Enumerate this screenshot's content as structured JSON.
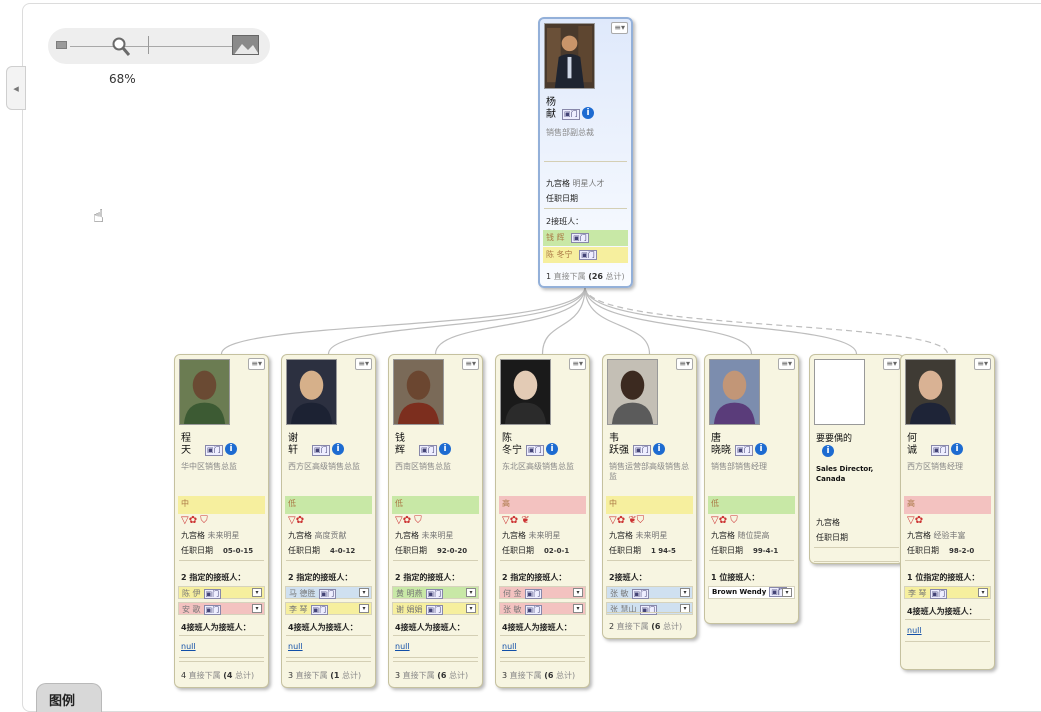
{
  "zoom": {
    "percent_label": "68%",
    "level": 0.35
  },
  "legend": {
    "label": "图例"
  },
  "labels": {
    "menu": "≡▾",
    "info": "i",
    "chat": "▣门",
    "loc_label": "九宫格",
    "date_label": "任职日期",
    "succ_designated": "2 指定的接班人：",
    "succ_two": "2接班人：",
    "succ_one": "1 位接班人：",
    "succ_one_designated": "1 位指定的接班人：",
    "succ_as": "4接班人为接班人：",
    "null_link": "null",
    "direct_reports": "直接下属",
    "total": "总计"
  },
  "root": {
    "name": "杨\n献",
    "title": "销售部副总裁",
    "loc_value": "明星人才",
    "succ_label": "2接班人：",
    "successors": [
      {
        "name": "钱 辉",
        "color": "g"
      },
      {
        "name": "陈 冬宁",
        "color": "y"
      }
    ],
    "footer_count": "1",
    "footer_total": "(26"
  },
  "cards": [
    {
      "name": "程\n天",
      "title": "华中区销售总监",
      "band": "中",
      "band_color": "y",
      "flags": "▽✿  ⛉",
      "loc_value": "未来明星",
      "date_value": "05-0-15",
      "succ_label": "2 指定的接班人：",
      "successors": [
        {
          "name": "陈 伊",
          "color": "y"
        },
        {
          "name": "安 歌",
          "color": "r"
        }
      ],
      "as_label": "4接班人为接班人：",
      "null": "null",
      "footer_count": "4",
      "footer_total": "(4"
    },
    {
      "name": "谢\n轩",
      "title": "西方区高级销售总监",
      "band": "低",
      "band_color": "g",
      "flags": "▽✿",
      "loc_value": "高度贡献",
      "date_value": "4-0-12",
      "succ_label": "2 指定的接班人：",
      "successors": [
        {
          "name": "马 德胜",
          "color": "b"
        },
        {
          "name": "李 琴",
          "color": "y"
        }
      ],
      "as_label": "4接班人为接班人：",
      "null": "null",
      "footer_count": "3",
      "footer_total": "(1"
    },
    {
      "name": "钱\n辉",
      "title": "西南区销售总监",
      "band": "低",
      "band_color": "g",
      "flags": "▽✿  ⛉",
      "loc_value": "未来明星",
      "date_value": "92-0-20",
      "succ_label": "2 指定的接班人：",
      "successors": [
        {
          "name": "黄 明燕",
          "color": "g"
        },
        {
          "name": "谢 娟娟",
          "color": "y"
        }
      ],
      "as_label": "4接班人为接班人：",
      "null": "null",
      "footer_count": "3",
      "footer_total": "(6"
    },
    {
      "name": "陈\n冬宁",
      "title": "东北区高级销售总监",
      "band": "高",
      "band_color": "r",
      "flags": "▽✿  ❦",
      "loc_value": "未来明星",
      "date_value": "02-0-1",
      "succ_label": "2 指定的接班人：",
      "successors": [
        {
          "name": "何 金",
          "color": "r"
        },
        {
          "name": "张 敏",
          "color": "r"
        }
      ],
      "as_label": "4接班人为接班人：",
      "null": "null",
      "footer_count": "3",
      "footer_total": "(6"
    },
    {
      "name": "韦\n跃强",
      "title": "销售运营部高级销售总监",
      "band": "中",
      "band_color": "y",
      "flags": "▽✿  ❦⛉",
      "loc_value": "未来明星",
      "date_value": "1 94-5",
      "succ_label": "2接班人：",
      "successors": [
        {
          "name": "张 敏",
          "color": "b"
        },
        {
          "name": "张 慧山",
          "color": "b"
        }
      ],
      "footer_count": "2",
      "footer_total": "(6"
    },
    {
      "name": "唐\n晓晓",
      "title": "销售部销售经理",
      "band": "低",
      "band_color": "g",
      "flags": "▽✿  ⛉",
      "loc_value": "随位提高",
      "date_value": "99-4-1",
      "succ_label": "1 位接班人：",
      "successors": [
        {
          "name": "Brown Wendy",
          "color": "w"
        }
      ]
    },
    {
      "name": "要要偶的",
      "title": "Sales Director, Canada",
      "loc_value": "",
      "date_value": ""
    },
    {
      "name": "何\n诚",
      "title": "西方区销售经理",
      "band": "高",
      "band_color": "r",
      "flags": "▽✿",
      "loc_value": "经验丰富",
      "date_value": "98-2-0",
      "succ_label": "1 位指定的接班人：",
      "successors": [
        {
          "name": "李 琴",
          "color": "y"
        }
      ],
      "as_label": "4接班人为接班人：",
      "null": "null"
    }
  ],
  "colors": {
    "card_bg": "#f7f5e1",
    "selected_border": "#93b0d9",
    "info_blue": "#1d6bd1",
    "band_yellow": "#f6ef9e",
    "band_green": "#c8e8a6",
    "band_red": "#f3c2c0"
  }
}
